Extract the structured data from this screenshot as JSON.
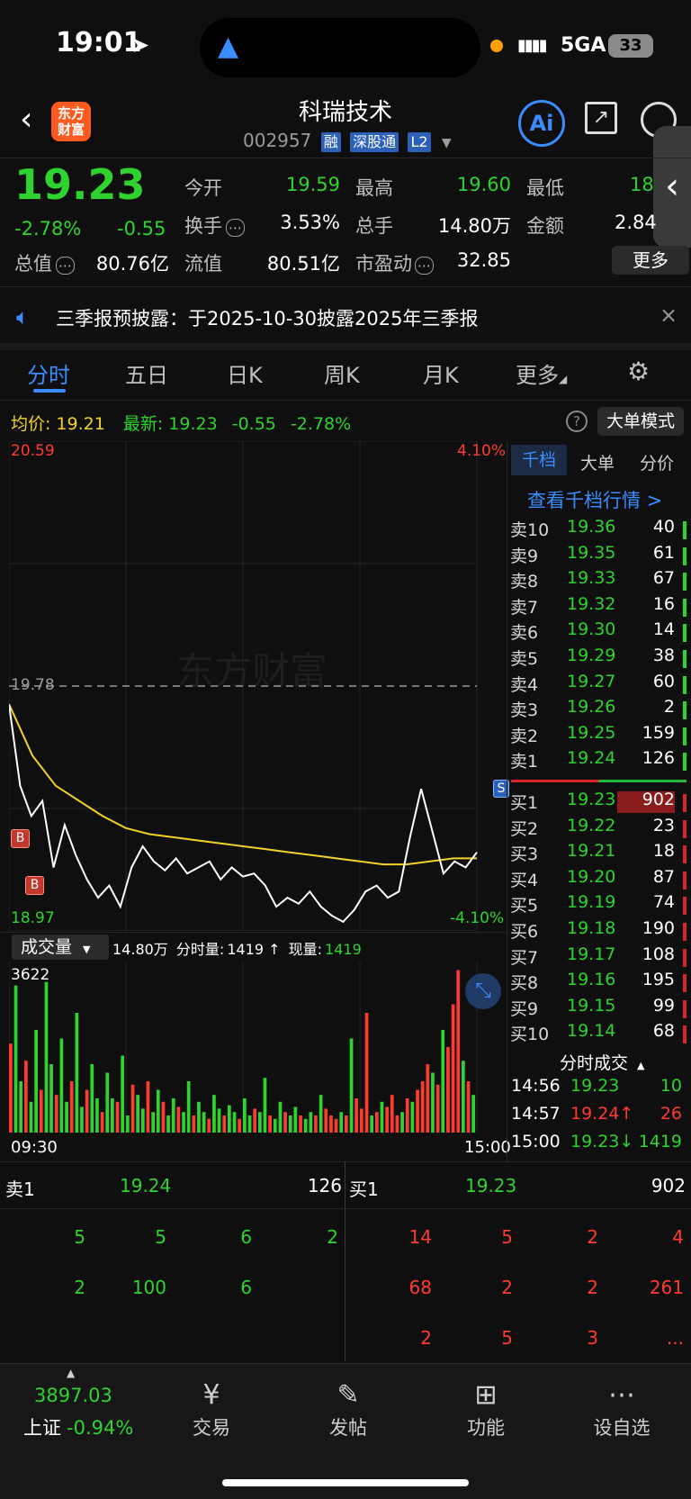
{
  "status_bar": {
    "time": "19:01",
    "network": "5GA",
    "battery": "33"
  },
  "header": {
    "logo_text": "东方财富",
    "stock_name": "科瑞技术",
    "stock_code": "002957",
    "tags": [
      "融",
      "深股通",
      "L2"
    ],
    "ai_label": "Ai"
  },
  "quote": {
    "price": "19.23",
    "change_pct": "-2.78%",
    "change": "-0.55",
    "open_label": "今开",
    "open": "19.59",
    "high_label": "最高",
    "high": "19.60",
    "low_label": "最低",
    "low": "18",
    "turnover_label": "换手",
    "turnover": "3.53%",
    "volume_label": "总手",
    "volume": "14.80万",
    "amount_label": "金额",
    "amount": "2.84",
    "mktcap_label": "总值",
    "mktcap": "80.76亿",
    "float_label": "流值",
    "float_cap": "80.51亿",
    "pe_label": "市盈动",
    "pe": "32.85",
    "more_button": "更多"
  },
  "notice": {
    "text": "三季报预披露：于2025-10-30披露2025年三季报"
  },
  "tabs": [
    "分时",
    "五日",
    "日K",
    "周K",
    "月K",
    "更多"
  ],
  "active_tab": "分时",
  "chart_info": {
    "avg_label": "均价:",
    "avg_value": "19.21",
    "latest_label": "最新:",
    "latest_value": "19.23",
    "change": "-0.55",
    "change_pct": "-2.78%",
    "big_order_button": "大单模式"
  },
  "chart_data": {
    "type": "line",
    "y_max_label": "20.59",
    "y_min_label": "18.97",
    "y_ref_label": "19.78",
    "pct_max_label": "4.10%",
    "pct_min_label": "-4.10%",
    "ylim": [
      18.97,
      20.59
    ],
    "reference": 19.78,
    "x_start_label": "09:30",
    "x_end_label": "15:00",
    "series": [
      {
        "values": [
          19.72,
          19.45,
          19.35,
          19.4,
          19.18,
          19.32,
          19.22,
          19.14,
          19.08,
          19.12,
          19.05,
          19.18,
          19.25,
          19.2,
          19.17,
          19.21,
          19.16,
          19.18,
          19.2,
          19.14,
          19.18,
          19.15,
          19.16,
          19.12,
          19.05,
          19.08,
          19.06,
          19.1,
          19.05,
          19.02,
          19.0,
          19.04,
          19.1,
          19.12,
          19.08,
          19.1,
          19.28,
          19.44,
          19.3,
          19.16,
          19.2,
          19.18,
          19.23
        ]
      },
      {
        "values": [
          19.72,
          19.55,
          19.45,
          19.4,
          19.35,
          19.31,
          19.29,
          19.28,
          19.27,
          19.26,
          19.25,
          19.24,
          19.23,
          19.22,
          19.21,
          19.2,
          19.19,
          19.19,
          19.2,
          19.21,
          19.21
        ]
      }
    ],
    "markers": [
      "B",
      "B",
      "S"
    ]
  },
  "volume_panel": {
    "selector_label": "成交量",
    "total": "14.80万",
    "minute_label": "分时量:",
    "minute_value": "1419",
    "arrow": "↑",
    "now_label": "现量:",
    "now_value": "1419",
    "max_label": "3622",
    "bars": [
      0.52,
      0.86,
      0.3,
      0.42,
      0.18,
      0.6,
      0.25,
      0.88,
      0.4,
      0.22,
      0.55,
      0.18,
      0.3,
      0.7,
      0.15,
      0.25,
      0.4,
      0.2,
      0.12,
      0.35,
      0.2,
      0.18,
      0.45,
      0.1,
      0.28,
      0.22,
      0.14,
      0.3,
      0.12,
      0.25,
      0.18,
      0.1,
      0.2,
      0.15,
      0.12,
      0.3,
      0.1,
      0.18,
      0.12,
      0.08,
      0.22,
      0.14,
      0.1,
      0.16,
      0.12,
      0.08,
      0.2,
      0.1,
      0.14,
      0.12,
      0.32,
      0.1,
      0.08,
      0.18,
      0.12,
      0.1,
      0.15,
      0.1,
      0.08,
      0.12,
      0.1,
      0.22,
      0.14,
      0.1,
      0.08,
      0.12,
      0.1,
      0.55,
      0.2,
      0.14,
      0.7,
      0.1,
      0.12,
      0.18,
      0.15,
      0.22,
      0.1,
      0.12,
      0.2,
      0.18,
      0.25,
      0.3,
      0.4,
      0.35,
      0.28,
      0.6,
      0.5,
      0.75,
      0.95,
      0.42,
      0.3,
      0.22
    ]
  },
  "depth": {
    "tabs": [
      "千档",
      "大单",
      "分价"
    ],
    "link": "查看千档行情 >",
    "asks": [
      {
        "label": "卖10",
        "price": "19.36",
        "vol": "40"
      },
      {
        "label": "卖9",
        "price": "19.35",
        "vol": "61"
      },
      {
        "label": "卖8",
        "price": "19.33",
        "vol": "67"
      },
      {
        "label": "卖7",
        "price": "19.32",
        "vol": "16"
      },
      {
        "label": "卖6",
        "price": "19.30",
        "vol": "14"
      },
      {
        "label": "卖5",
        "price": "19.29",
        "vol": "38"
      },
      {
        "label": "卖4",
        "price": "19.27",
        "vol": "60"
      },
      {
        "label": "卖3",
        "price": "19.26",
        "vol": "2"
      },
      {
        "label": "卖2",
        "price": "19.25",
        "vol": "159"
      },
      {
        "label": "卖1",
        "price": "19.24",
        "vol": "126"
      }
    ],
    "bids": [
      {
        "label": "买1",
        "price": "19.23",
        "vol": "902"
      },
      {
        "label": "买2",
        "price": "19.22",
        "vol": "23"
      },
      {
        "label": "买3",
        "price": "19.21",
        "vol": "18"
      },
      {
        "label": "买4",
        "price": "19.20",
        "vol": "87"
      },
      {
        "label": "买5",
        "price": "19.19",
        "vol": "74"
      },
      {
        "label": "买6",
        "price": "19.18",
        "vol": "190"
      },
      {
        "label": "买7",
        "price": "19.17",
        "vol": "108"
      },
      {
        "label": "买8",
        "price": "19.16",
        "vol": "195"
      },
      {
        "label": "买9",
        "price": "19.15",
        "vol": "99"
      },
      {
        "label": "买10",
        "price": "19.14",
        "vol": "68"
      }
    ],
    "trades_title": "分时成交",
    "trades": [
      {
        "time": "14:56",
        "price": "19.23",
        "vol": "10"
      },
      {
        "time": "14:57",
        "price": "19.24↑",
        "vol": "26"
      },
      {
        "time": "15:00",
        "price": "19.23↓",
        "vol": "1419"
      }
    ]
  },
  "order_queue": {
    "sell_label": "卖1",
    "sell_price": "19.24",
    "sell_vol": "126",
    "buy_label": "买1",
    "buy_price": "19.23",
    "buy_vol": "902",
    "sell_rows": [
      [
        "5",
        "5",
        "6",
        "2"
      ],
      [
        "2",
        "100",
        "6",
        ""
      ]
    ],
    "buy_rows": [
      [
        "14",
        "5",
        "2",
        "4"
      ],
      [
        "68",
        "2",
        "2",
        "261"
      ],
      [
        "2",
        "5",
        "3",
        "..."
      ]
    ]
  },
  "bottom_nav": {
    "index_value": "3897.03",
    "index_name": "上证",
    "index_change": "-0.94%",
    "items": [
      "交易",
      "发帖",
      "功能",
      "设自选"
    ]
  },
  "colors": {
    "up": "#ff3b30",
    "down": "#2fd32f",
    "avg_line": "#f2d12b",
    "accent": "#3b8cff"
  }
}
